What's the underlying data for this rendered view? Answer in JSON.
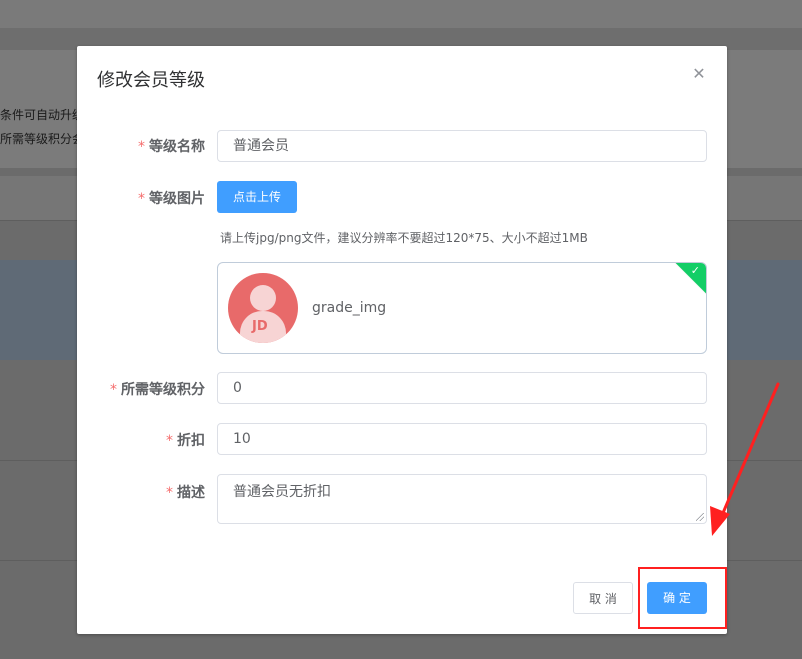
{
  "background": {
    "line1": "条件可自动升级",
    "line2": "所需等级积分会"
  },
  "dialog": {
    "title": "修改会员等级",
    "close_icon": "close-icon"
  },
  "form": {
    "required_mark": "*",
    "level_name": {
      "label": "等级名称",
      "value": "普通会员"
    },
    "level_image": {
      "label": "等级图片",
      "upload_label": "点击上传",
      "tip": "请上传jpg/png文件，建议分辨率不要超过120*75、大小不超过1MB",
      "file_name": "grade_img",
      "thumb_text": "JD",
      "status_icon": "check-icon"
    },
    "points": {
      "label": "所需等级积分",
      "value": "0"
    },
    "discount": {
      "label": "折扣",
      "value": "10"
    },
    "description": {
      "label": "描述",
      "value": "普通会员无折扣"
    }
  },
  "footer": {
    "cancel_label": "取 消",
    "confirm_label": "确 定"
  },
  "colors": {
    "primary": "#409eff",
    "success": "#13ce66",
    "required": "#f56c6c",
    "annotation": "#ff2020"
  }
}
